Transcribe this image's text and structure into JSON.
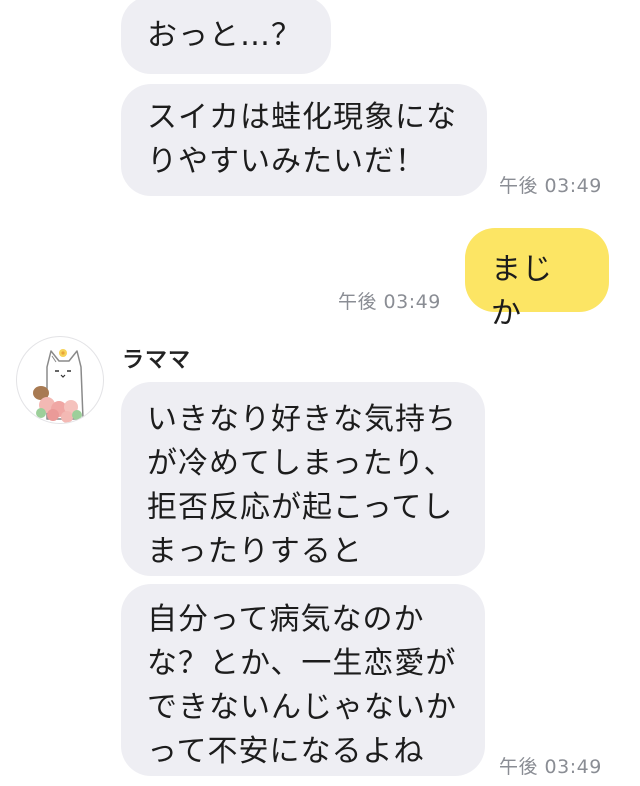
{
  "chat": {
    "messages": [
      {
        "side": "partner",
        "text": "おっと…？"
      },
      {
        "side": "partner",
        "text": "スイカは蛙化現象にな\nりやすいみたいだ！",
        "time": "午後 03:49"
      },
      {
        "side": "me",
        "text": "まじか",
        "time": "午後 03:49"
      },
      {
        "side": "partner",
        "sender": "ラママ",
        "text": "いきなり好きな気持ち\nが冷めてしまったり、\n拒否反応が起こってし\nまったりすると"
      },
      {
        "side": "partner",
        "text": "自分って病気なのか\nな？とか、一生恋愛が\nできないんじゃないか\nって不安になるよね",
        "time": "午後 03:49"
      }
    ]
  },
  "colors": {
    "partner_bubble": "#eeeef3",
    "my_bubble": "#fce564",
    "timestamp": "#8a8d94"
  },
  "icons": {
    "avatar": "white-cat-with-flowers-avatar"
  }
}
